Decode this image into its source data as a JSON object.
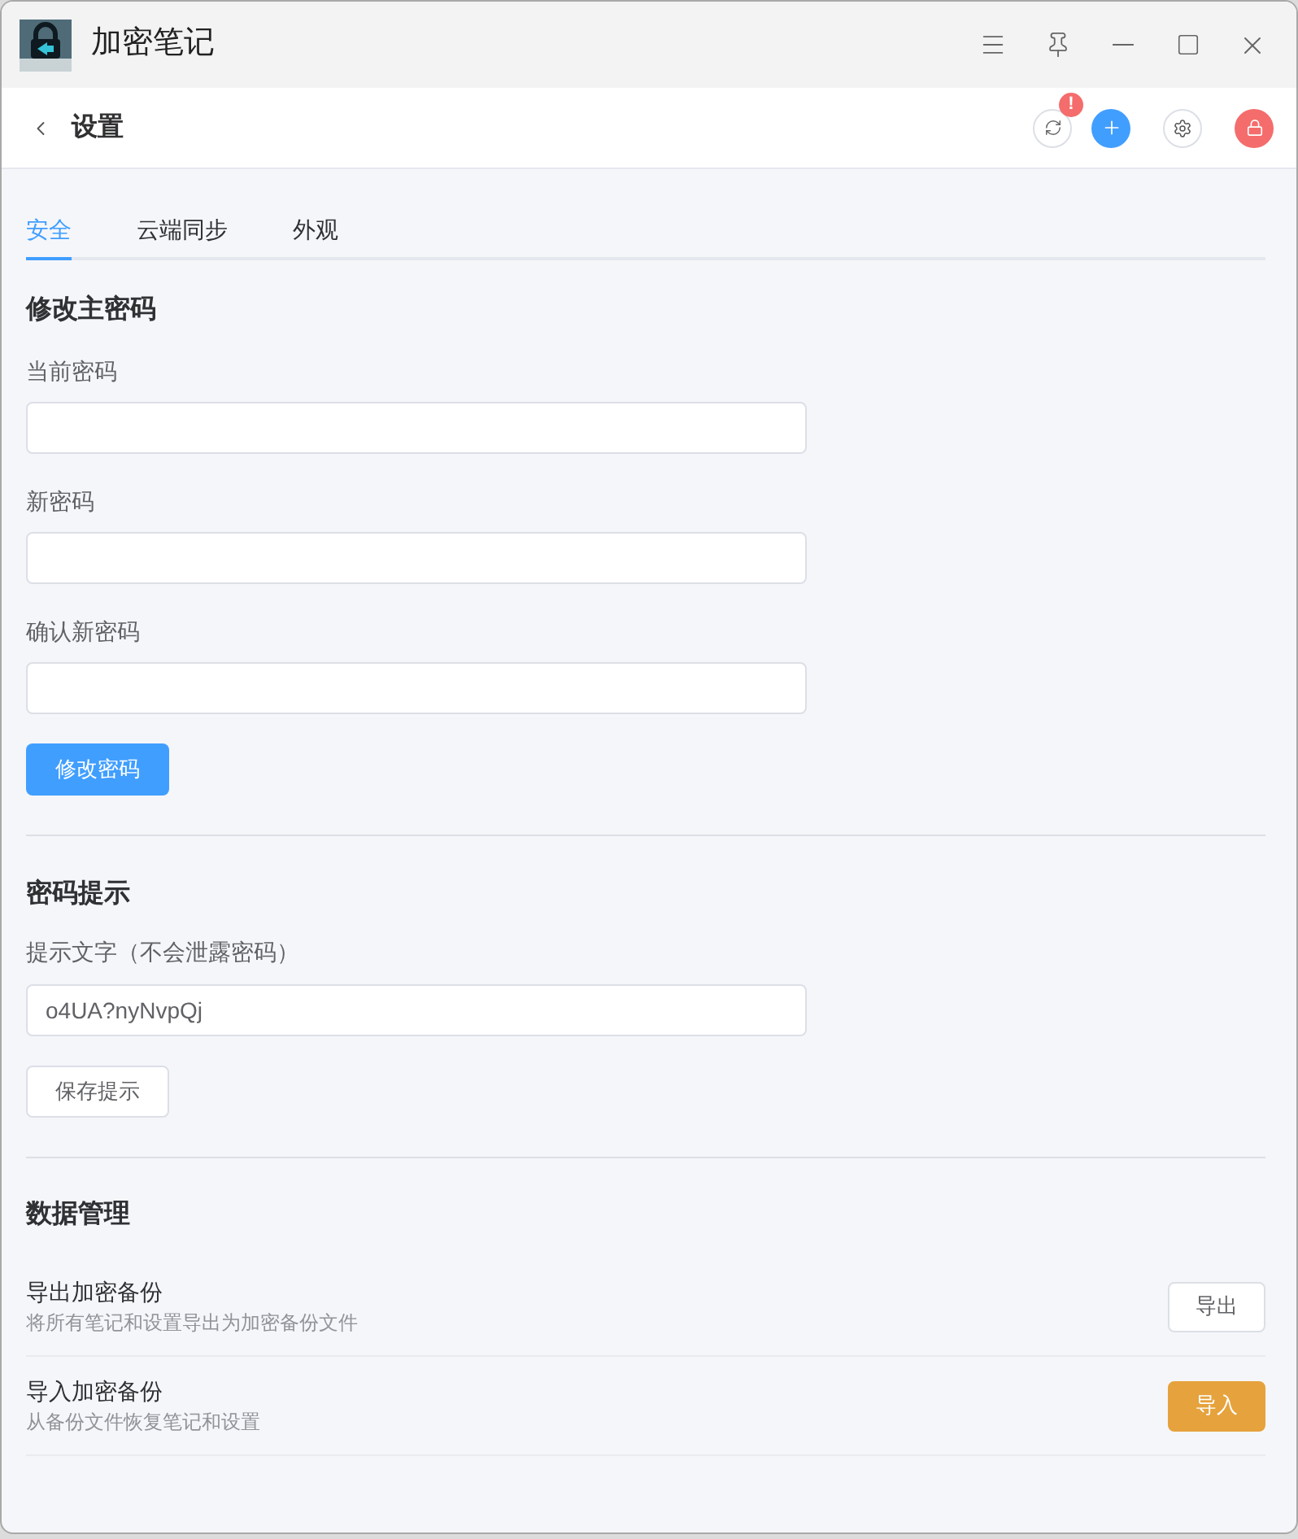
{
  "window": {
    "title": "加密笔记"
  },
  "header": {
    "title": "设置",
    "sync_badge": "!"
  },
  "tabs": [
    {
      "label": "安全",
      "selected": true
    },
    {
      "label": "云端同步",
      "selected": false
    },
    {
      "label": "外观",
      "selected": false
    }
  ],
  "change_password": {
    "title": "修改主密码",
    "fields": [
      {
        "label": "当前密码"
      },
      {
        "label": "新密码"
      },
      {
        "label": "确认新密码"
      }
    ],
    "button": "修改密码"
  },
  "password_hint": {
    "title": "密码提示",
    "label": "提示文字（不会泄露密码）",
    "value": "o4UA?nyNvpQj",
    "button": "保存提示"
  },
  "data_management": {
    "title": "数据管理",
    "rows": [
      {
        "title": "导出加密备份",
        "description": "将所有笔记和设置导出为加密备份文件",
        "button": "导出",
        "kind": "default"
      },
      {
        "title": "导入加密备份",
        "description": "从备份文件恢复笔记和设置",
        "button": "导入",
        "kind": "warning"
      }
    ]
  }
}
